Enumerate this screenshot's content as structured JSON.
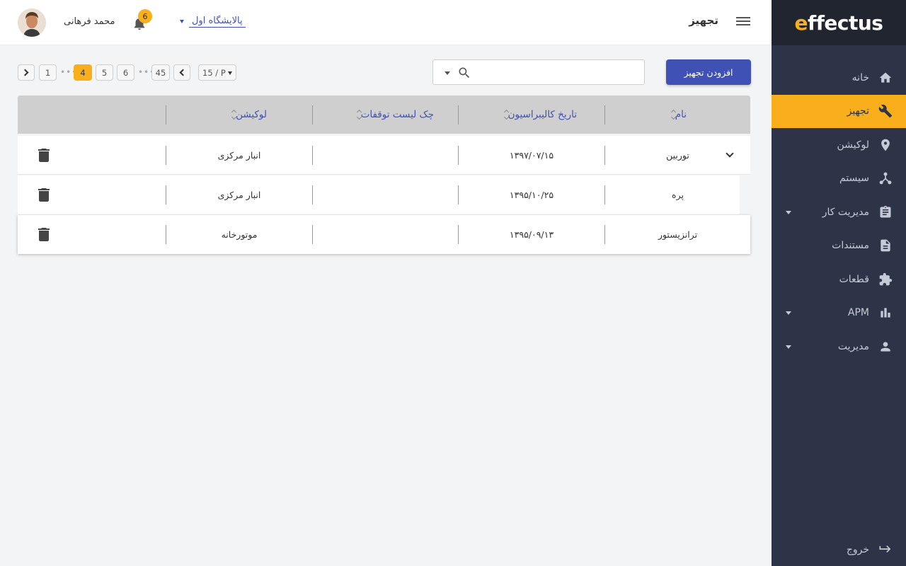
{
  "brand": {
    "logo_e": "e",
    "logo_rest": "ffectus",
    "accent": "#f9ae1b",
    "primary": "#3f51b5",
    "sidebar_bg": "#2d3447"
  },
  "header": {
    "page_title": "تجهیز",
    "user_name": "محمد فرهانی",
    "notification_count": "6",
    "site_selector": "پالایشگاه اول"
  },
  "sidebar": {
    "items": [
      {
        "label": "خانه",
        "icon": "home-icon"
      },
      {
        "label": "تجهیز",
        "icon": "wrench-icon",
        "active": true
      },
      {
        "label": "لوکیشن",
        "icon": "location-pin-icon"
      },
      {
        "label": "سیستم",
        "icon": "network-icon"
      },
      {
        "label": "مدیریت کار",
        "icon": "clipboard-icon",
        "expandable": true
      },
      {
        "label": "مستندات",
        "icon": "document-icon"
      },
      {
        "label": "قطعات",
        "icon": "puzzle-icon"
      },
      {
        "label": "APM",
        "icon": "bar-chart-icon",
        "expandable": true
      },
      {
        "label": "مدیریت",
        "icon": "person-icon",
        "expandable": true
      }
    ],
    "logout": "خروج"
  },
  "toolbar": {
    "add_button": "افزودن تجهیز",
    "search_placeholder": ""
  },
  "pagination": {
    "page_size": "15 / P",
    "pages": [
      "1",
      "4",
      "5",
      "6",
      "45"
    ],
    "current": "4"
  },
  "table": {
    "columns": [
      "نام",
      "تاریخ کالیبراسیون",
      "چک لیست توقفات",
      "لوکیشن"
    ],
    "rows": [
      {
        "name": "توربین",
        "calibration_date": "۱۳۹۷/۰۷/۱۵",
        "checklist": "",
        "location": "انبار مرکزی"
      },
      {
        "name": "پره",
        "calibration_date": "۱۳۹۵/۱۰/۲۵",
        "checklist": "",
        "location": "انبار مرکزی"
      },
      {
        "name": "ترانزیستور",
        "calibration_date": "۱۳۹۵/۰۹/۱۳",
        "checklist": "",
        "location": "موتورخانه"
      }
    ]
  }
}
